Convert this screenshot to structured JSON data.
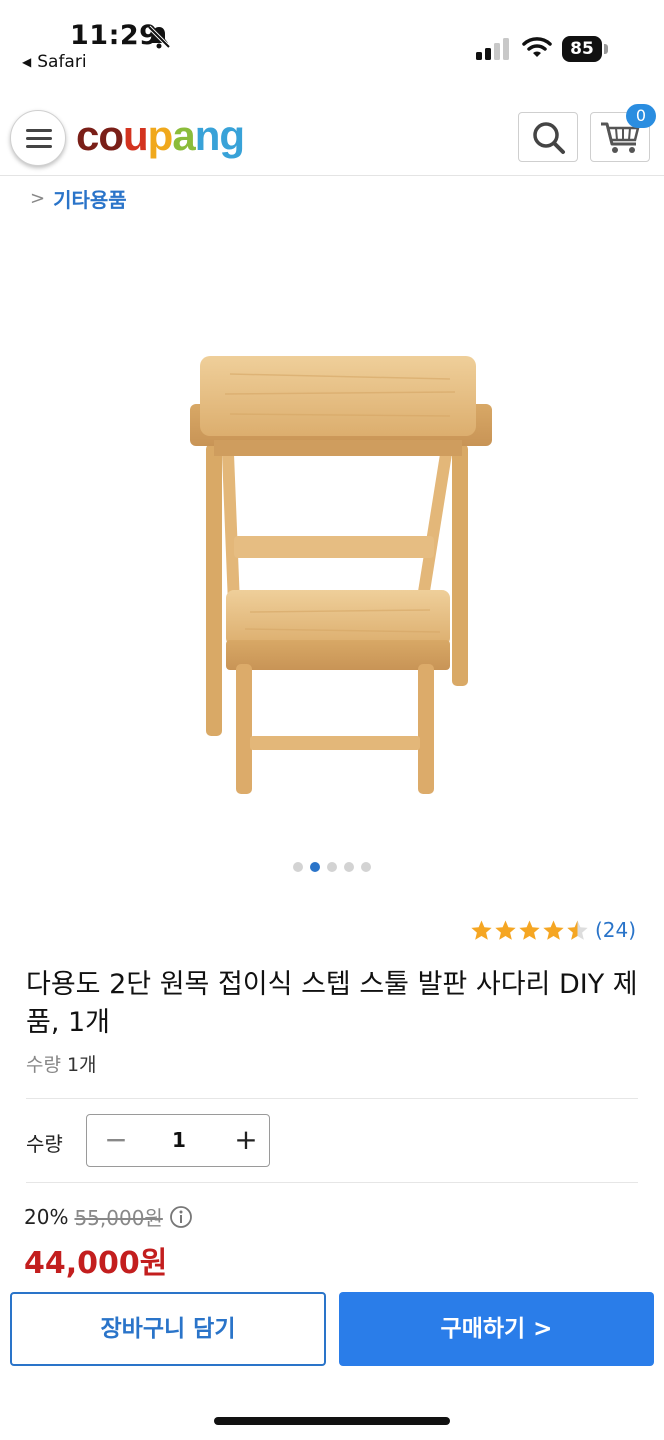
{
  "status_bar": {
    "time": "11:29",
    "back_app": "Safari",
    "battery": "85",
    "icons": [
      "bell-slash-icon",
      "signal-icon",
      "wifi-icon",
      "battery-icon"
    ]
  },
  "header": {
    "logo_letters": [
      "c",
      "o",
      "u",
      "p",
      "a",
      "n",
      "g"
    ],
    "cart_count": "0",
    "icons": [
      "menu-icon",
      "search-icon",
      "cart-icon"
    ]
  },
  "breadcrumb": {
    "category": "기타용품"
  },
  "gallery": {
    "image": "wooden-folding-step-stool-photo",
    "total_images": 5,
    "active_index": 1
  },
  "product": {
    "rating": 4.5,
    "rating_count": "(24)",
    "title": "다용도 2단 원목 접이식 스텝 스툴 발판 사다리 DIY 제품, 1개",
    "option_label": "수량",
    "option_value": "1개"
  },
  "quantity": {
    "label": "수량",
    "value": "1",
    "minus": "−",
    "plus": "+"
  },
  "price": {
    "discount": "20%",
    "original": "55,000원",
    "final": "44,000원"
  },
  "actions": {
    "add_to_cart": "장바구니 담기",
    "buy_now": "구매하기 >"
  },
  "colors": {
    "brand_blue": "#2a74c9",
    "buy_button": "#2a7de9",
    "price_red": "#c31e1e",
    "star": "#f5a623",
    "logo": [
      "#7a1f18",
      "#7a1f18",
      "#d3331f",
      "#f0a81c",
      "#8bbc3a",
      "#38a2d8",
      "#38a2d8"
    ]
  }
}
